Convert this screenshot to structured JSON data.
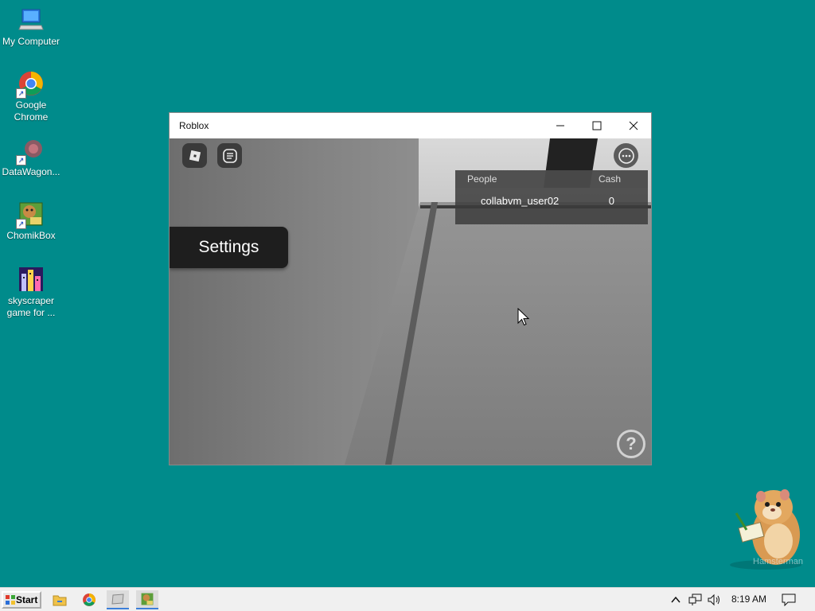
{
  "desktop": {
    "icons": [
      {
        "label": "My Computer"
      },
      {
        "label": "Google Chrome"
      },
      {
        "label": "DataWagon..."
      },
      {
        "label": "ChomikBox"
      },
      {
        "label": "skyscraper game for ..."
      }
    ]
  },
  "window": {
    "title": "Roblox",
    "settings_label": "Settings",
    "leaderboard": {
      "headers": [
        "People",
        "Cash"
      ],
      "rows": [
        {
          "name": "collabvm_user02",
          "cash": "0"
        }
      ]
    },
    "help_label": "?"
  },
  "taskbar": {
    "start_label": "Start",
    "clock": "8:19 AM"
  },
  "mascot_label": "Hamsterman",
  "colors": {
    "desktop_bg": "#008b8b",
    "taskbar_bg": "#f0f0f0",
    "accent": "#3c7fd9"
  }
}
